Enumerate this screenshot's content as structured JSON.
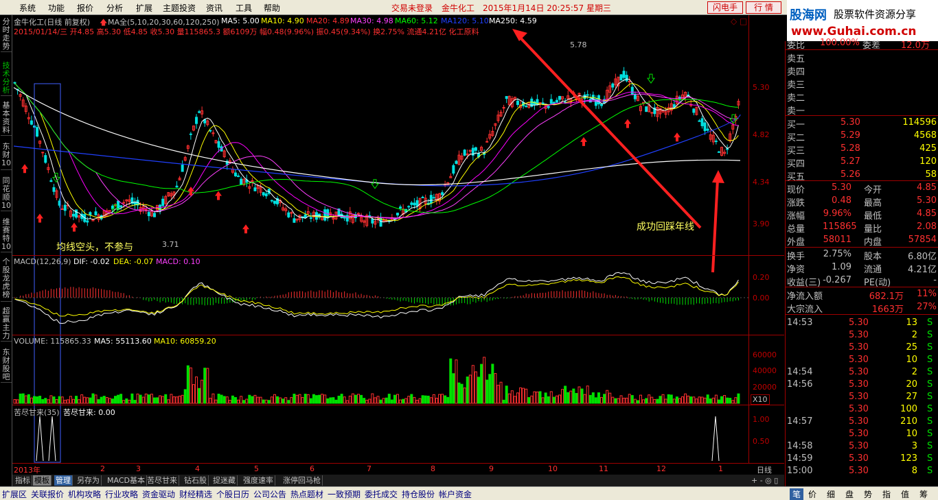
{
  "menu": [
    "系统",
    "功能",
    "报价",
    "分析",
    "扩展",
    "主题投资",
    "资讯",
    "工具",
    "帮助"
  ],
  "top_status": {
    "trade": "交易未登录",
    "stock": "金牛化工",
    "datetime": "2015年1月14日 20:25:57 星期三"
  },
  "top_buttons": [
    "闪电手",
    "行  情"
  ],
  "brand": {
    "name": "股海网",
    "slogan": "股票软件资源分享",
    "url": "www.Guhai.com.cn"
  },
  "left_tabs": [
    "分时走势",
    "技术分析",
    "基本资料",
    "东财10",
    "同花顺10",
    "维赛特10",
    "个股龙虎榜",
    "超赢主力",
    "东财股吧"
  ],
  "main_chart": {
    "title": "金牛化工(日线 前复权)",
    "ma_label": "MA全(5,10,20,30,60,120,250)",
    "ma5": "MA5: 5.00",
    "ma10": "MA10: 4.90",
    "ma20": "MA20: 4.89",
    "ma30": "MA30: 4.98",
    "ma60": "MA60: 5.12",
    "ma120": "MA120: 5.10",
    "ma250": "MA250: 4.59",
    "bar_info": "2015/01/14/三 开4.85 高5.30 低4.85 收5.30 量115865.3 额6109万 幅0.48(9.96%) 振0.45(9.34%) 换2.75% 流通4.21亿 化工原料",
    "annot_left": "均线空头，不参与",
    "annot_right": "成功回踩年线",
    "high_label": "5.78",
    "low_label": "3.71",
    "yticks": [
      "5.30",
      "4.82",
      "4.34",
      "3.90"
    ]
  },
  "macd": {
    "title": "MACD(12,26,9)",
    "dif": "DIF: -0.02",
    "dea": "DEA: -0.07",
    "macd": "MACD: 0.10",
    "yticks": [
      "0.20",
      "0.00"
    ]
  },
  "volume": {
    "title": "VOLUME: 115865.33",
    "ma5": "MA5: 55113.60",
    "ma10": "MA10: 60859.20",
    "yticks": [
      "60000",
      "40000",
      "20000"
    ],
    "unit": "X10"
  },
  "kujin": {
    "title": "苦尽甘来(35)",
    "value": "苦尽甘来: 0.00",
    "yticks": [
      "1.00",
      "0.50"
    ]
  },
  "x_axis": [
    "2013年",
    "2",
    "3",
    "4",
    "5",
    "6",
    "7",
    "8",
    "9",
    "10",
    "11",
    "12",
    "1"
  ],
  "period": "日线",
  "bottom_tabs": [
    "指标",
    "模板",
    "管理",
    "另存为",
    "MACD基本",
    "苦尽甘来",
    "钻石股",
    "捉迷藏",
    "强度速率",
    "涨停回马枪"
  ],
  "quote": {
    "weibi": [
      "委比",
      "100.00%",
      "委差",
      "12.0万"
    ],
    "sell": [
      [
        "卖五",
        ""
      ],
      [
        "卖四",
        ""
      ],
      [
        "卖三",
        ""
      ],
      [
        "卖二",
        ""
      ],
      [
        "卖一",
        ""
      ]
    ],
    "buy": [
      [
        "买一",
        "5.30",
        "114596"
      ],
      [
        "买二",
        "5.29",
        "4568"
      ],
      [
        "买三",
        "5.28",
        "425"
      ],
      [
        "买四",
        "5.27",
        "120"
      ],
      [
        "买五",
        "5.26",
        "58"
      ]
    ],
    "stats": [
      [
        "现价",
        "5.30",
        "今开",
        "4.85"
      ],
      [
        "涨跌",
        "0.48",
        "最高",
        "5.30"
      ],
      [
        "涨幅",
        "9.96%",
        "最低",
        "4.85"
      ],
      [
        "总量",
        "115865",
        "量比",
        "2.08"
      ],
      [
        "外盘",
        "58011",
        "内盘",
        "57854"
      ]
    ],
    "stats2": [
      [
        "换手",
        "2.75%",
        "股本",
        "6.80亿"
      ],
      [
        "净资",
        "1.09",
        "流通",
        "4.21亿"
      ],
      [
        "收益(三)",
        "-0.267",
        "PE(动)",
        "-"
      ]
    ],
    "flow": [
      [
        "净流入额",
        "682.1万",
        "11%"
      ],
      [
        "大宗流入",
        "1663万",
        "27%"
      ]
    ],
    "ticks": [
      [
        "14:53",
        "5.30",
        "13",
        "S"
      ],
      [
        "",
        "5.30",
        "2",
        "S"
      ],
      [
        "",
        "5.30",
        "25",
        "S"
      ],
      [
        "",
        "5.30",
        "10",
        "S"
      ],
      [
        "14:54",
        "5.30",
        "2",
        "S"
      ],
      [
        "14:56",
        "5.30",
        "20",
        "S"
      ],
      [
        "",
        "5.30",
        "27",
        "S"
      ],
      [
        "",
        "5.30",
        "100",
        "S"
      ],
      [
        "14:57",
        "5.30",
        "210",
        "S"
      ],
      [
        "",
        "5.30",
        "10",
        "S"
      ],
      [
        "14:58",
        "5.30",
        "3",
        "S"
      ],
      [
        "14:59",
        "5.30",
        "123",
        "S"
      ],
      [
        "15:00",
        "5.30",
        "8",
        "S"
      ]
    ]
  },
  "status_tabs": [
    "扩展区",
    "关联报价",
    "机构攻略",
    "行业攻略",
    "资金驱动",
    "财经精选",
    "个股日历",
    "公司公告",
    "热点题材",
    "一致预期",
    "委托成交",
    "持仓股份",
    "帐户资金"
  ],
  "right_tabs": [
    "笔",
    "价",
    "细",
    "盘",
    "势",
    "指",
    "值",
    "筹"
  ],
  "colors": {
    "up": "#ff3030",
    "down": "#00e000",
    "ma5": "#ffffff",
    "ma10": "#ffff00",
    "ma20": "#ff00ff",
    "ma30": "#00ff00",
    "ma60": "#00ff00",
    "ma120": "#2040ff",
    "ma250": "#ffffff",
    "accent": "#ff0000"
  }
}
